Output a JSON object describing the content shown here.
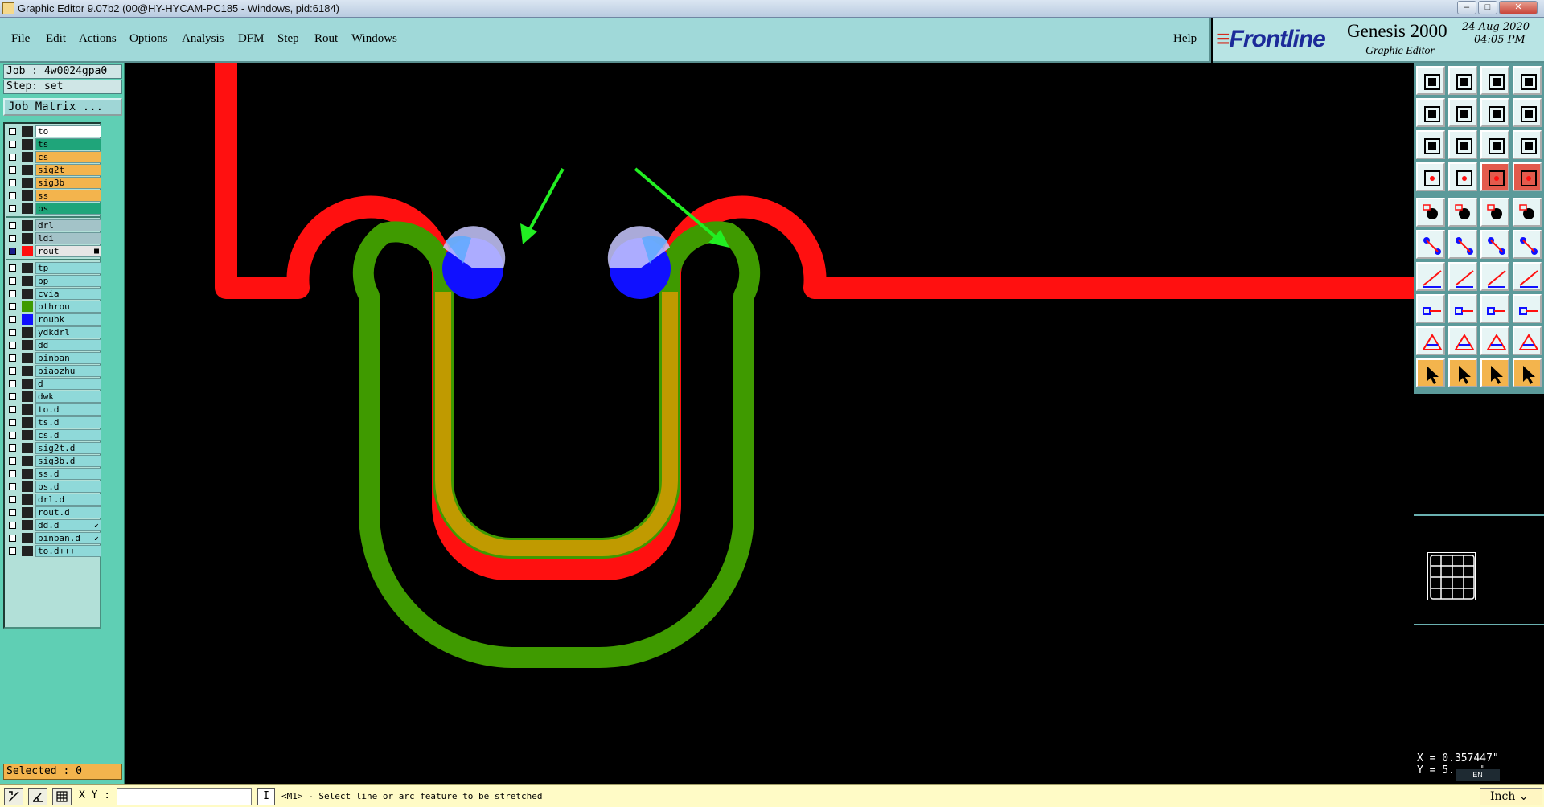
{
  "window": {
    "title": "Graphic Editor 9.07b2 (00@HY-HYCAM-PC185 - Windows, pid:6184)",
    "buttons": [
      "–",
      "□",
      "✕"
    ]
  },
  "menu": {
    "items": [
      {
        "label": "File"
      },
      {
        "label": "Edit"
      },
      {
        "label": "Actions"
      },
      {
        "label": "Options"
      },
      {
        "label": "Analysis"
      },
      {
        "label": "DFM"
      },
      {
        "label": "Step"
      },
      {
        "label": "Rout"
      },
      {
        "label": "Windows"
      }
    ],
    "help": "Help"
  },
  "logo": {
    "brand": "Frontline",
    "product": "Genesis 2000",
    "subtitle": "Graphic Editor",
    "date": "24 Aug 2020",
    "time": "04:05 PM"
  },
  "left_panel": {
    "job": "Job : 4w0024gpa0",
    "step": "Step: set",
    "job_matrix": "Job Matrix ...",
    "selected": "Selected : 0",
    "layers": [
      {
        "name": "to",
        "color": "#ffffff",
        "swatch": "#222222",
        "group": 1
      },
      {
        "name": "ts",
        "color": "#1fa57a",
        "swatch": "#222222",
        "group": 1
      },
      {
        "name": "cs",
        "color": "#f3b44d",
        "swatch": "#222222",
        "group": 1
      },
      {
        "name": "sig2t",
        "color": "#f3b44d",
        "swatch": "#222222",
        "group": 1
      },
      {
        "name": "sig3b",
        "color": "#f3b44d",
        "swatch": "#222222",
        "group": 1
      },
      {
        "name": "ss",
        "color": "#f3b44d",
        "swatch": "#222222",
        "group": 1
      },
      {
        "name": "bs",
        "color": "#1fa57a",
        "swatch": "#222222",
        "group": 1
      },
      {
        "name": "drl",
        "color": "#a3c3c8",
        "swatch": "#222222",
        "group": 2
      },
      {
        "name": "ldi",
        "color": "#a3c3c8",
        "swatch": "#222222",
        "group": 2
      },
      {
        "name": "rout",
        "color": "#e6e6e6",
        "swatch": "#ff1010",
        "group": 2,
        "flag": "■",
        "active": true
      },
      {
        "name": "tp",
        "color": "#8fd9d9",
        "swatch": "#222222",
        "group": 3
      },
      {
        "name": "bp",
        "color": "#8fd9d9",
        "swatch": "#222222",
        "group": 3
      },
      {
        "name": "cvia",
        "color": "#8fd9d9",
        "swatch": "#222222",
        "group": 3
      },
      {
        "name": "pthrou",
        "color": "#8fd9d9",
        "swatch": "#3f9a00",
        "group": 3
      },
      {
        "name": "roubk",
        "color": "#8fd9d9",
        "swatch": "#1010ff",
        "group": 3
      },
      {
        "name": "ydkdrl",
        "color": "#8fd9d9",
        "swatch": "#222222",
        "group": 3
      },
      {
        "name": "dd",
        "color": "#8fd9d9",
        "swatch": "#222222",
        "group": 3
      },
      {
        "name": "pinban",
        "color": "#8fd9d9",
        "swatch": "#222222",
        "group": 3
      },
      {
        "name": "biaozhu",
        "color": "#8fd9d9",
        "swatch": "#222222",
        "group": 3
      },
      {
        "name": "d",
        "color": "#8fd9d9",
        "swatch": "#222222",
        "group": 3
      },
      {
        "name": "dwk",
        "color": "#8fd9d9",
        "swatch": "#222222",
        "group": 3
      },
      {
        "name": "to.d",
        "color": "#8fd9d9",
        "swatch": "#222222",
        "group": 3
      },
      {
        "name": "ts.d",
        "color": "#8fd9d9",
        "swatch": "#222222",
        "group": 3
      },
      {
        "name": "cs.d",
        "color": "#8fd9d9",
        "swatch": "#222222",
        "group": 3
      },
      {
        "name": "sig2t.d",
        "color": "#8fd9d9",
        "swatch": "#222222",
        "group": 3
      },
      {
        "name": "sig3b.d",
        "color": "#8fd9d9",
        "swatch": "#222222",
        "group": 3
      },
      {
        "name": "ss.d",
        "color": "#8fd9d9",
        "swatch": "#222222",
        "group": 3
      },
      {
        "name": "bs.d",
        "color": "#8fd9d9",
        "swatch": "#222222",
        "group": 3
      },
      {
        "name": "drl.d",
        "color": "#8fd9d9",
        "swatch": "#222222",
        "group": 3
      },
      {
        "name": "rout.d",
        "color": "#8fd9d9",
        "swatch": "#222222",
        "group": 3
      },
      {
        "name": "dd.d",
        "color": "#8fd9d9",
        "swatch": "#222222",
        "group": 3,
        "flag": "↙"
      },
      {
        "name": "pinban.d",
        "color": "#8fd9d9",
        "swatch": "#222222",
        "group": 3,
        "flag": "↙"
      },
      {
        "name": "to.d+++",
        "color": "#8fd9d9",
        "swatch": "#222222",
        "group": 3
      }
    ]
  },
  "canvas": {
    "colors": {
      "rout": "#ff1010",
      "pthrou": "#3f9a00",
      "roubk": "#1010ff",
      "annotation_arrow": "#22ee22"
    }
  },
  "toolbar": {
    "rows": [
      [
        "snapshot-icon",
        "open-icon",
        "home-icon",
        "layout-icon"
      ],
      [
        "prev-step-icon",
        "next-step-icon",
        "pan-icon",
        "redraw-icon"
      ],
      [
        "zoom-fit-icon",
        "zoom-center-icon",
        "scale-icon",
        "help-icon"
      ],
      [
        "helicopter-icon",
        "measure-tool-icon",
        "layer-stack-red-icon",
        "layer-stack-red2-icon"
      ],
      [
        "add-pad-icon",
        "transform-icon",
        "ruler-icon",
        "fill-circle-icon"
      ],
      [
        "node-connect-icon",
        "delete-node-icon",
        "move-node-icon",
        "split-node-icon"
      ],
      [
        "line-draw-icon",
        "line-select-icon",
        "arc-icon",
        "align-icon"
      ],
      [
        "add-feature-icon",
        "line-edit-icon",
        "stretch-icon",
        "node-move-icon"
      ],
      [
        "triangle-icon",
        "text-a-icon",
        "text-a2-icon",
        "text-a3-icon"
      ],
      [
        "pointer-icon",
        "select-pointer-icon",
        "pick-pointer-icon",
        "path-pointer-icon"
      ]
    ],
    "styles": [
      [
        "light",
        "light",
        "light",
        "light"
      ],
      [
        "light",
        "light",
        "light",
        "light"
      ],
      [
        "light",
        "light",
        "light",
        "light"
      ],
      [
        "light",
        "light",
        "red",
        "red"
      ],
      [
        "light",
        "light",
        "light",
        "light"
      ],
      [
        "light",
        "light",
        "light",
        "light"
      ],
      [
        "light",
        "light",
        "light",
        "light"
      ],
      [
        "light",
        "light",
        "light",
        "light"
      ],
      [
        "light",
        "light",
        "light",
        "light"
      ],
      [
        "orange",
        "orange",
        "orange",
        "orange"
      ]
    ]
  },
  "coords": {
    "x": "X = 0.357447\"",
    "y": "Y = 5.....\""
  },
  "language_badge": "EN",
  "status_bar": {
    "xy_label": "X Y :",
    "xy_value": "",
    "prompt_icon": "I",
    "prompt": "<M1> - Select line or arc feature to be stretched",
    "units": "Inch"
  }
}
